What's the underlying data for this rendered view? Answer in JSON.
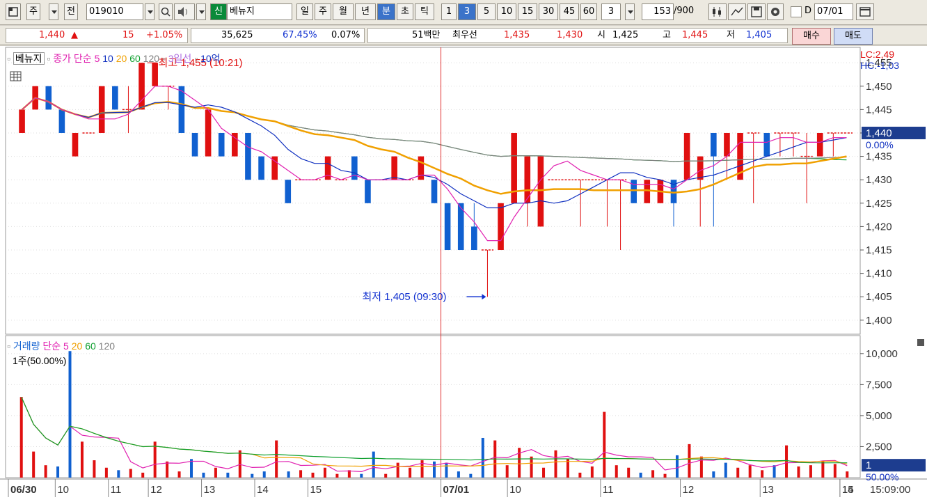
{
  "toolbar": {
    "market": "주",
    "market2": "전",
    "code": "019010",
    "sin": "신",
    "name": "베뉴지",
    "periods": [
      "일",
      "주",
      "월",
      "년",
      "분",
      "초",
      "틱"
    ],
    "selected_period": "분",
    "minutes": [
      "1",
      "3",
      "5",
      "10",
      "15",
      "30",
      "45",
      "60"
    ],
    "selected_minute": "3",
    "interval_value": "3",
    "count": "153",
    "count_total": "/900",
    "d_label": "D",
    "date": "07/01"
  },
  "quote": {
    "price": "1,440",
    "change": "15",
    "change_pct": "+1.05%",
    "volume": "35,625",
    "vol_ratio": "67.45%",
    "turnover": "0.07%",
    "amount": "51백만",
    "best_label": "최우선",
    "best_ask": "1,435",
    "best_bid": "1,430",
    "open_label": "시",
    "open": "1,425",
    "high_label": "고",
    "high": "1,445",
    "low_label": "저",
    "low": "1,405",
    "buy_label": "매수",
    "sell_label": "매도"
  },
  "price_legend": {
    "name": "베뉴지",
    "close": "종가 단순",
    "ma": [
      "5",
      "10",
      "20",
      "60",
      "120"
    ],
    "ilmok": "3일선",
    "amount": "10억",
    "lc": "LC:2,49",
    "hc": "HC:-1,03",
    "high_note": "최고 1,455 (10:21)",
    "low_note": "최저 1,405 (09:30)",
    "current_price": "1,440",
    "current_pct": "0.00%"
  },
  "volume_legend": {
    "name": "거래량",
    "ma_label": "단순",
    "ma": [
      "5",
      "20",
      "60",
      "120"
    ],
    "subtitle": "1주(50.00%)",
    "current": "1",
    "current_pct": "50.00%"
  },
  "time_axis": {
    "labels": [
      "06/30",
      "10",
      "11",
      "12",
      "13",
      "14",
      "15",
      "07/01",
      "10",
      "11",
      "12",
      "13",
      "14",
      "15"
    ],
    "clock": "15:09:00"
  },
  "colors": {
    "up": "#e01010",
    "down": "#1060d0",
    "ma5": "#e020b0",
    "ma10": "#1030c0",
    "ma20": "#f0a000",
    "ma60": "#10a030",
    "ma120": "#808080",
    "ilmok": "#b070e0"
  },
  "chart_data": {
    "type": "candlestick",
    "price_axis": {
      "ticks": [
        1455,
        1450,
        1445,
        1440,
        1435,
        1430,
        1425,
        1420,
        1415,
        1410,
        1405,
        1400
      ],
      "ylim": [
        1397,
        1458
      ]
    },
    "volume_axis": {
      "ticks": [
        10000,
        7500,
        5000,
        2500
      ],
      "ylim": [
        0,
        11000
      ]
    },
    "candles": [
      [
        1440,
        1445,
        1440,
        1445
      ],
      [
        1445,
        1450,
        1445,
        1450
      ],
      [
        1450,
        1450,
        1445,
        1445
      ],
      [
        1445,
        1445,
        1440,
        1440
      ],
      [
        1435,
        1440,
        1435,
        1440
      ],
      [
        1440,
        1440,
        1440,
        1440
      ],
      [
        1440,
        1450,
        1440,
        1450
      ],
      [
        1450,
        1450,
        1445,
        1445
      ],
      [
        1445,
        1450,
        1440,
        1445
      ],
      [
        1445,
        1455,
        1445,
        1455
      ],
      [
        1450,
        1455,
        1450,
        1455
      ],
      [
        1450,
        1450,
        1445,
        1450
      ],
      [
        1450,
        1450,
        1440,
        1440
      ],
      [
        1440,
        1440,
        1435,
        1435
      ],
      [
        1435,
        1445,
        1435,
        1445
      ],
      [
        1440,
        1440,
        1435,
        1435
      ],
      [
        1435,
        1440,
        1435,
        1440
      ],
      [
        1440,
        1440,
        1430,
        1430
      ],
      [
        1435,
        1435,
        1430,
        1430
      ],
      [
        1430,
        1435,
        1430,
        1435
      ],
      [
        1430,
        1430,
        1425,
        1425
      ],
      [
        1430,
        1430,
        1430,
        1430
      ],
      [
        1430,
        1430,
        1430,
        1430
      ],
      [
        1430,
        1435,
        1430,
        1435
      ],
      [
        1430,
        1430,
        1430,
        1430
      ],
      [
        1435,
        1435,
        1430,
        1430
      ],
      [
        1430,
        1430,
        1425,
        1425
      ],
      [
        1430,
        1430,
        1430,
        1430
      ],
      [
        1430,
        1435,
        1430,
        1435
      ],
      [
        1430,
        1430,
        1430,
        1430
      ],
      [
        1430,
        1435,
        1430,
        1435
      ],
      [
        1430,
        1430,
        1425,
        1425
      ],
      [
        1425,
        1420,
        1415,
        1415
      ],
      [
        1425,
        1425,
        1415,
        1415
      ],
      [
        1420,
        1425,
        1415,
        1415
      ],
      [
        1415,
        1415,
        1405,
        1415
      ],
      [
        1415,
        1425,
        1415,
        1425
      ],
      [
        1425,
        1440,
        1425,
        1440
      ],
      [
        1425,
        1435,
        1420,
        1435
      ],
      [
        1420,
        1435,
        1420,
        1435
      ],
      [
        1430,
        1430,
        1430,
        1430
      ],
      [
        1430,
        1430,
        1430,
        1430
      ],
      [
        1430,
        1430,
        1420,
        1430
      ],
      [
        1430,
        1430,
        1430,
        1430
      ],
      [
        1430,
        1430,
        1420,
        1430
      ],
      [
        1430,
        1430,
        1415,
        1430
      ],
      [
        1430,
        1430,
        1425,
        1425
      ],
      [
        1425,
        1430,
        1425,
        1430
      ],
      [
        1425,
        1430,
        1425,
        1430
      ],
      [
        1430,
        1430,
        1420,
        1425
      ],
      [
        1430,
        1440,
        1430,
        1440
      ],
      [
        1430,
        1435,
        1420,
        1435
      ],
      [
        1440,
        1440,
        1420,
        1435
      ],
      [
        1435,
        1440,
        1430,
        1440
      ],
      [
        1430,
        1440,
        1430,
        1440
      ],
      [
        1440,
        1440,
        1425,
        1440
      ],
      [
        1440,
        1440,
        1435,
        1435
      ],
      [
        1440,
        1440,
        1435,
        1440
      ],
      [
        1440,
        1440,
        1435,
        1440
      ],
      [
        1435,
        1440,
        1425,
        1435
      ],
      [
        1435,
        1440,
        1435,
        1440
      ],
      [
        1440,
        1440,
        1435,
        1440
      ],
      [
        1440,
        1440,
        1440,
        1440
      ]
    ],
    "volume": [
      6500,
      2100,
      1000,
      900,
      10200,
      2900,
      1400,
      800,
      600,
      700,
      400,
      2900,
      1300,
      500,
      1500,
      400,
      800,
      400,
      2200,
      300,
      500,
      3000,
      500,
      600,
      400,
      800,
      300,
      600,
      300,
      2100,
      300,
      1200,
      800,
      1400,
      1300,
      1200,
      500,
      300,
      3200,
      3000,
      1000,
      2400,
      1700,
      800,
      2200,
      1500,
      400,
      900,
      5300,
      1000,
      800,
      400,
      600,
      300,
      1800,
      2700,
      1700,
      500,
      1200,
      800,
      1000,
      600,
      1000,
      2600,
      900,
      1000,
      1300,
      1100,
      500
    ]
  }
}
